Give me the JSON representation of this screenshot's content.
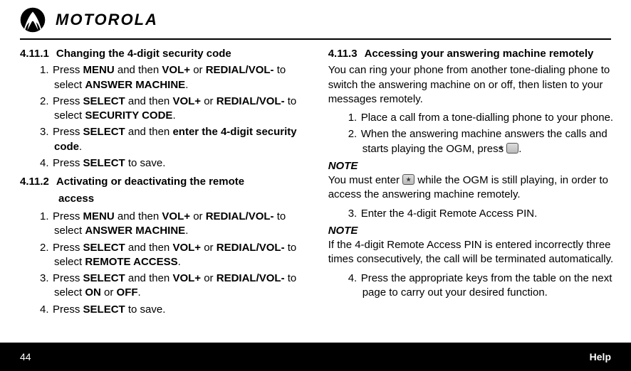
{
  "brand": "MOTOROLA",
  "left": {
    "s1": {
      "num": "4.11.1",
      "title": "Changing the 4-digit security code"
    },
    "s1steps": [
      {
        "n": "1.",
        "pre": "Press ",
        "b1": "MENU",
        "mid1": " and then ",
        "b2": "VOL+",
        "mid2": " or ",
        "b3": "REDIAL/VOL-",
        "mid3": " to select ",
        "b4": "ANSWER MACHINE",
        "post": "."
      },
      {
        "n": "2.",
        "pre": "Press ",
        "b1": "SELECT",
        "mid1": " and then ",
        "b2": "VOL+",
        "mid2": " or ",
        "b3": "REDIAL/VOL-",
        "mid3": " to select ",
        "b4": "SECURITY CODE",
        "post": "."
      },
      {
        "n": "3.",
        "pre": "Press ",
        "b1": "SELECT",
        "mid1": " and then ",
        "b2": "enter the 4-digit security code",
        "mid2": "",
        "b3": "",
        "mid3": "",
        "b4": "",
        "post": "."
      },
      {
        "n": "4.",
        "pre": "Press ",
        "b1": "SELECT",
        "mid1": " to save.",
        "b2": "",
        "mid2": "",
        "b3": "",
        "mid3": "",
        "b4": "",
        "post": ""
      }
    ],
    "s2": {
      "num": "4.11.2",
      "title1": "Activating or deactivating the remote",
      "title2": "access"
    },
    "s2steps": [
      {
        "n": "1.",
        "pre": "Press ",
        "b1": "MENU",
        "mid1": " and then ",
        "b2": "VOL+",
        "mid2": " or ",
        "b3": "REDIAL/VOL-",
        "mid3": " to select ",
        "b4": "ANSWER MACHINE",
        "post": "."
      },
      {
        "n": "2.",
        "pre": "Press ",
        "b1": "SELECT",
        "mid1": " and then ",
        "b2": "VOL+",
        "mid2": " or ",
        "b3": "REDIAL/VOL-",
        "mid3": " to select ",
        "b4": "REMOTE ACCESS",
        "post": "."
      },
      {
        "n": "3.",
        "pre": "Press ",
        "b1": "SELECT",
        "mid1": " and then ",
        "b2": "VOL+",
        "mid2": " or ",
        "b3": "REDIAL/VOL-",
        "mid3": " to select ",
        "b4": "ON",
        "mid4": " or ",
        "b5": "OFF",
        "post": "."
      },
      {
        "n": "4.",
        "pre": "Press ",
        "b1": "SELECT",
        "mid1": " to save.",
        "b2": "",
        "mid2": "",
        "b3": "",
        "mid3": "",
        "b4": "",
        "post": ""
      }
    ]
  },
  "right": {
    "s3": {
      "num": "4.11.3",
      "title": "Accessing your answering machine remotely"
    },
    "intro": "You can ring your phone from another tone-dialing phone to switch the answering machine on or off, then listen to your messages remotely.",
    "steps_a": [
      {
        "n": "1.",
        "t": "Place a call from a tone-dialling phone to your phone."
      },
      {
        "n": "2.",
        "t": "When the answering machine answers the calls and starts playing the OGM, press ",
        "icon": true,
        "post": "."
      }
    ],
    "note1_h": "NOTE",
    "note1_pre": "You must enter ",
    "note1_post": " while the OGM is still playing, in order to access the answering machine remotely.",
    "step3": {
      "n": "3.",
      "t": "Enter the 4-digit Remote Access PIN."
    },
    "note2_h": "NOTE",
    "note2": "If the 4-digit Remote Access PIN is entered incorrectly three times consecutively, the call will be terminated automatically.",
    "step4": {
      "n": "4.",
      "t": "Press the appropriate keys from the table on the next page to carry out your desired function."
    }
  },
  "footer": {
    "page": "44",
    "title": "Help"
  }
}
